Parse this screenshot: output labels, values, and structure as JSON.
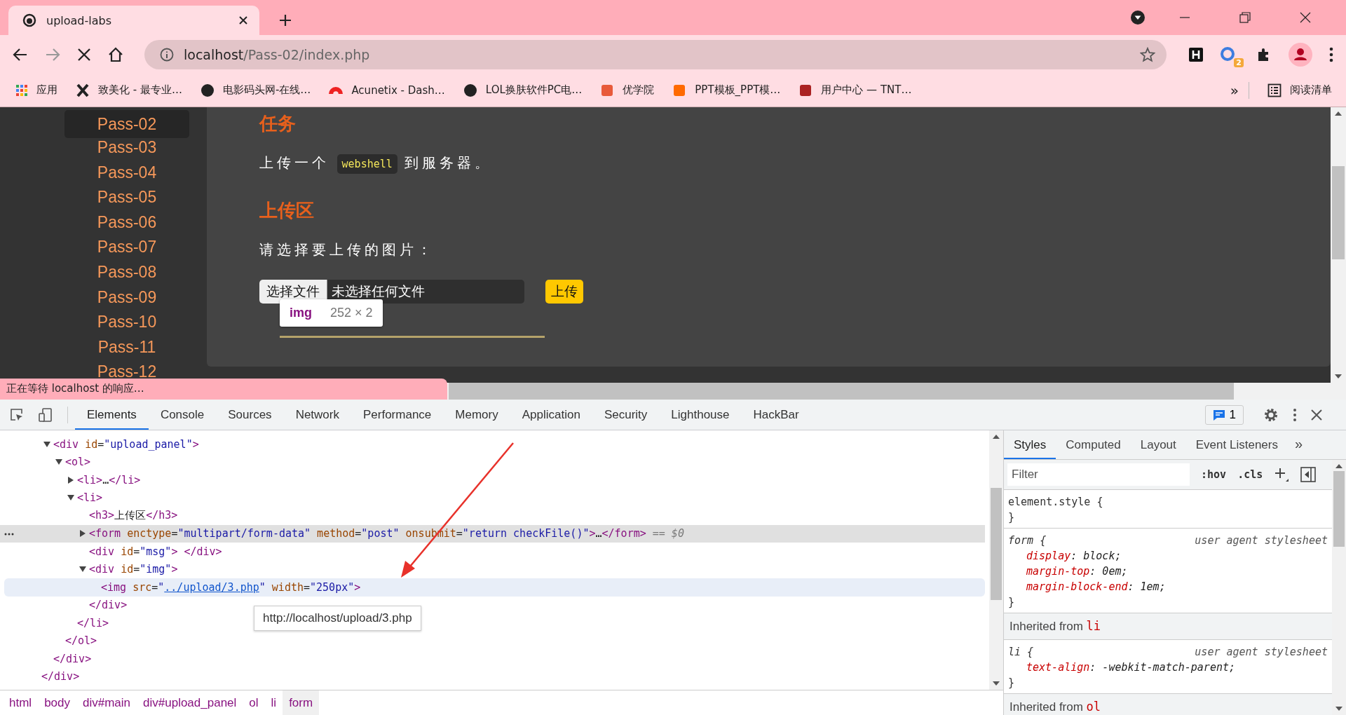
{
  "browser": {
    "tab_title": "upload-labs",
    "host": "localhost",
    "path": "/Pass-02/index.php",
    "bookmarks": [
      {
        "label": "应用"
      },
      {
        "label": "致美化 - 最专业…"
      },
      {
        "label": "电影码头网-在线…"
      },
      {
        "label": "Acunetix - Dash…"
      },
      {
        "label": "LOL换肤软件PC电…"
      },
      {
        "label": "优学院"
      },
      {
        "label": "PPT模板_PPT模…"
      },
      {
        "label": "用户中心 — TNT…"
      }
    ],
    "bookmarks_more": "»",
    "reading_list": "阅读清单",
    "extension_badge": "2",
    "status": "正在等待 localhost 的响应…"
  },
  "page": {
    "sidebar": [
      {
        "label": "Pass-02",
        "selected": true
      },
      {
        "label": "Pass-03",
        "selected": false
      },
      {
        "label": "Pass-04",
        "selected": false
      },
      {
        "label": "Pass-05",
        "selected": false
      },
      {
        "label": "Pass-06",
        "selected": false
      },
      {
        "label": "Pass-07",
        "selected": false
      },
      {
        "label": "Pass-08",
        "selected": false
      },
      {
        "label": "Pass-09",
        "selected": false
      },
      {
        "label": "Pass-10",
        "selected": false
      },
      {
        "label": "Pass-11",
        "selected": false
      },
      {
        "label": "Pass-12",
        "selected": false
      }
    ],
    "task_heading": "任务",
    "task_before": "上传一个",
    "task_code": "webshell",
    "task_after": "到服务器。",
    "upload_heading": "上传区",
    "prompt": "请选择要上传的图片：",
    "choose_button": "选择文件",
    "no_file": "未选择任何文件",
    "upload_button": "上传",
    "inspect_tag": "img",
    "inspect_size": "252 × 2"
  },
  "devtools": {
    "tabs": [
      {
        "label": "Elements",
        "selected": true
      },
      {
        "label": "Console",
        "selected": false
      },
      {
        "label": "Sources",
        "selected": false
      },
      {
        "label": "Network",
        "selected": false
      },
      {
        "label": "Performance",
        "selected": false
      },
      {
        "label": "Memory",
        "selected": false
      },
      {
        "label": "Application",
        "selected": false
      },
      {
        "label": "Security",
        "selected": false
      },
      {
        "label": "Lighthouse",
        "selected": false
      },
      {
        "label": "HackBar",
        "selected": false
      }
    ],
    "issues": "1",
    "dom": {
      "close": [
        {
          "kind": "tag",
          "text": "</div>"
        }
      ],
      "children": [
        {
          "parts": [
            {
              "kind": "tag",
              "text": "<div"
            },
            {
              "kind": "attr",
              "text": " id"
            },
            {
              "kind": "p",
              "text": "="
            },
            {
              "kind": "val",
              "text": "\"upload_panel\""
            },
            {
              "kind": "tag",
              "text": ">"
            }
          ],
          "expanded": true,
          "selected": false,
          "hovered": false,
          "close": [
            {
              "kind": "tag",
              "text": "</div>"
            }
          ],
          "children": [
            {
              "parts": [
                {
                  "kind": "tag",
                  "text": "<ol>"
                }
              ],
              "expanded": true,
              "selected": false,
              "hovered": false,
              "close": [
                {
                  "kind": "tag",
                  "text": "</ol>"
                }
              ],
              "children": [
                {
                  "parts": [
                    {
                      "kind": "tag",
                      "text": "<li>"
                    },
                    {
                      "kind": "text",
                      "text": "…"
                    },
                    {
                      "kind": "tag",
                      "text": "</li>"
                    }
                  ],
                  "expanded": false,
                  "selected": false,
                  "hovered": false
                },
                {
                  "parts": [
                    {
                      "kind": "tag",
                      "text": "<li>"
                    }
                  ],
                  "expanded": true,
                  "selected": false,
                  "hovered": false,
                  "close": [
                    {
                      "kind": "tag",
                      "text": "</li>"
                    }
                  ],
                  "children": [
                    {
                      "parts": [
                        {
                          "kind": "tag",
                          "text": "<h3>"
                        },
                        {
                          "kind": "text",
                          "text": "上传区"
                        },
                        {
                          "kind": "tag",
                          "text": "</h3>"
                        }
                      ],
                      "selected": false,
                      "hovered": false
                    },
                    {
                      "parts": [
                        {
                          "kind": "tag",
                          "text": "<form"
                        },
                        {
                          "kind": "attr",
                          "text": " enctype"
                        },
                        {
                          "kind": "p",
                          "text": "="
                        },
                        {
                          "kind": "val",
                          "text": "\"multipart/form-data\""
                        },
                        {
                          "kind": "attr",
                          "text": " method"
                        },
                        {
                          "kind": "p",
                          "text": "="
                        },
                        {
                          "kind": "val",
                          "text": "\"post\""
                        },
                        {
                          "kind": "attr",
                          "text": " onsubmit"
                        },
                        {
                          "kind": "p",
                          "text": "="
                        },
                        {
                          "kind": "val",
                          "text": "\"return checkFile()\""
                        },
                        {
                          "kind": "tag",
                          "text": ">"
                        },
                        {
                          "kind": "text",
                          "text": "…"
                        },
                        {
                          "kind": "tag",
                          "text": "</form>"
                        },
                        {
                          "kind": "marker",
                          "text": " == $0"
                        }
                      ],
                      "expanded": false,
                      "selected": true,
                      "hovered": false
                    },
                    {
                      "parts": [
                        {
                          "kind": "tag",
                          "text": "<div"
                        },
                        {
                          "kind": "attr",
                          "text": " id"
                        },
                        {
                          "kind": "p",
                          "text": "="
                        },
                        {
                          "kind": "val",
                          "text": "\"msg\""
                        },
                        {
                          "kind": "tag",
                          "text": "> </div>"
                        }
                      ],
                      "selected": false,
                      "hovered": false
                    },
                    {
                      "parts": [
                        {
                          "kind": "tag",
                          "text": "<div"
                        },
                        {
                          "kind": "attr",
                          "text": " id"
                        },
                        {
                          "kind": "p",
                          "text": "="
                        },
                        {
                          "kind": "val",
                          "text": "\"img\""
                        },
                        {
                          "kind": "tag",
                          "text": ">"
                        }
                      ],
                      "expanded": true,
                      "selected": false,
                      "hovered": false,
                      "close": [
                        {
                          "kind": "tag",
                          "text": "</div>"
                        }
                      ],
                      "children": [
                        {
                          "parts": [
                            {
                              "kind": "tag",
                              "text": "<img"
                            },
                            {
                              "kind": "attr",
                              "text": " src"
                            },
                            {
                              "kind": "p",
                              "text": "="
                            },
                            {
                              "kind": "val",
                              "text": "\""
                            },
                            {
                              "kind": "link",
                              "text": "../upload/3.php"
                            },
                            {
                              "kind": "val",
                              "text": "\""
                            },
                            {
                              "kind": "attr",
                              "text": " width"
                            },
                            {
                              "kind": "p",
                              "text": "="
                            },
                            {
                              "kind": "val",
                              "text": "\"250px\""
                            },
                            {
                              "kind": "tag",
                              "text": ">"
                            }
                          ],
                          "selected": false,
                          "hovered": true
                        }
                      ]
                    }
                  ]
                }
              ]
            }
          ]
        }
      ]
    },
    "link_tooltip": "http://localhost/upload/3.php",
    "breadcrumbs": [
      {
        "label": "html",
        "selected": false
      },
      {
        "label": "body",
        "selected": false
      },
      {
        "label": "div#main",
        "selected": false
      },
      {
        "label": "div#upload_panel",
        "selected": false
      },
      {
        "label": "ol",
        "selected": false
      },
      {
        "label": "li",
        "selected": false
      },
      {
        "label": "form",
        "selected": true
      }
    ],
    "side_tabs": [
      {
        "label": "Styles",
        "selected": true
      },
      {
        "label": "Computed",
        "selected": false
      },
      {
        "label": "Layout",
        "selected": false
      },
      {
        "label": "Event Listeners",
        "selected": false
      }
    ],
    "side_more": "»",
    "filter_placeholder": "Filter",
    "hov": ":hov",
    "cls": ".cls",
    "rules": [
      {
        "kind": "rule",
        "selector": "element.style {",
        "end": "}"
      },
      {
        "kind": "rule",
        "selector": "form {",
        "origin": "user agent stylesheet",
        "decls": [
          {
            "name": "display",
            "value": ": block;"
          },
          {
            "name": "margin-top",
            "value": ": 0em;"
          },
          {
            "name": "margin-block-end",
            "value": ": 1em;"
          }
        ],
        "end": "}"
      },
      {
        "kind": "inherited",
        "label": "Inherited from",
        "tag": "li"
      },
      {
        "kind": "rule",
        "selector": "li {",
        "origin": "user agent stylesheet",
        "decls": [
          {
            "name": "text-align",
            "value": ": -webkit-match-parent;"
          }
        ],
        "end": "}"
      },
      {
        "kind": "inherited",
        "label": "Inherited from",
        "tag": "ol"
      }
    ]
  }
}
